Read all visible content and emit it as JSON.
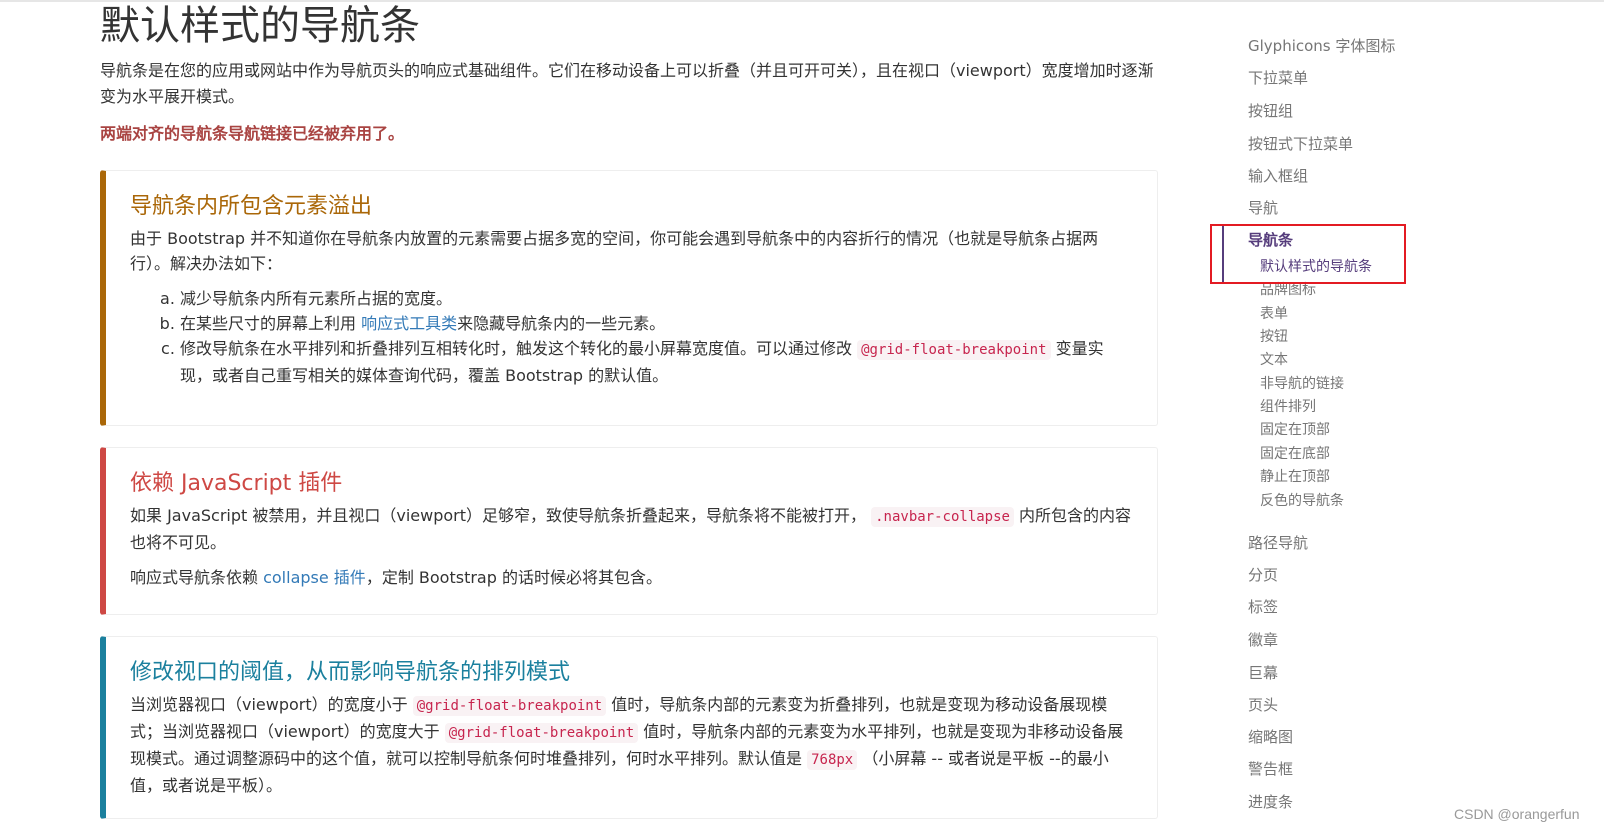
{
  "main": {
    "title": "默认样式的导航条",
    "lead": "导航条是在您的应用或网站中作为导航页头的响应式基础组件。它们在移动设备上可以折叠（并且可开可关），且在视口（viewport）宽度增加时逐渐变为水平展开模式。",
    "deprecated": "两端对齐的导航条导航链接已经被弃用了。",
    "callout1": {
      "title": "导航条内所包含元素溢出",
      "intro": "由于 Bootstrap 并不知道你在导航条内放置的元素需要占据多宽的空间，你可能会遇到导航条中的内容折行的情况（也就是导航条占据两行）。解决办法如下：",
      "item_a": "减少导航条内所有元素所占据的宽度。",
      "item_b_pre": "在某些尺寸的屏幕上利用 ",
      "item_b_link": "响应式工具类",
      "item_b_post": "来隐藏导航条内的一些元素。",
      "item_c_pre": "修改导航条在水平排列和折叠排列互相转化时，触发这个转化的最小屏幕宽度值。可以通过修改 ",
      "item_c_code": "@grid-float-breakpoint",
      "item_c_post": " 变量实现，或者自己重写相关的媒体查询代码，覆盖 Bootstrap 的默认值。"
    },
    "callout2": {
      "title": "依赖 JavaScript 插件",
      "p1_pre": "如果 JavaScript 被禁用，并且视口（viewport）足够窄，致使导航条折叠起来，导航条将不能被打开， ",
      "p1_code": ".navbar-collapse",
      "p1_post": " 内所包含的内容也将不可见。",
      "p2_pre": "响应式导航条依赖 ",
      "p2_link": "collapse 插件",
      "p2_post": "，定制 Bootstrap 的话时候必将其包含。"
    },
    "callout3": {
      "title": "修改视口的阈值，从而影响导航条的排列模式",
      "t1": "当浏览器视口（viewport）的宽度小于 ",
      "code1": "@grid-float-breakpoint",
      "t2": " 值时，导航条内部的元素变为折叠排列，也就是变现为移动设备展现模式；当浏览器视口（viewport）的宽度大于 ",
      "code2": "@grid-float-breakpoint",
      "t3": " 值时，导航条内部的元素变为水平排列，也就是变现为非移动设备展现模式。通过调整源码中的这个值，就可以控制导航条何时堆叠排列，何时水平排列。默认值是 ",
      "code3": "768px",
      "t4": " （小屏幕 -- 或者说是平板 --的最小值，或者说是平板）。"
    }
  },
  "sidebar": {
    "items_top": [
      "Glyphicons 字体图标",
      "下拉菜单",
      "按钮组",
      "按钮式下拉菜单",
      "输入框组",
      "导航"
    ],
    "active_item": "导航条",
    "sub_items": [
      "默认样式的导航条",
      "品牌图标",
      "表单",
      "按钮",
      "文本",
      "非导航的链接",
      "组件排列",
      "固定在顶部",
      "固定在底部",
      "静止在顶部",
      "反色的导航条"
    ],
    "items_bottom": [
      "路径导航",
      "分页",
      "标签",
      "徽章",
      "巨幕",
      "页头",
      "缩略图",
      "警告框",
      "进度条"
    ]
  },
  "watermark": "CSDN @orangerfun",
  "colors": {
    "warning": "#aa6708",
    "danger": "#ce4844",
    "info": "#1b809e",
    "active": "#563d7c",
    "highlight_box": "#e31b23"
  }
}
